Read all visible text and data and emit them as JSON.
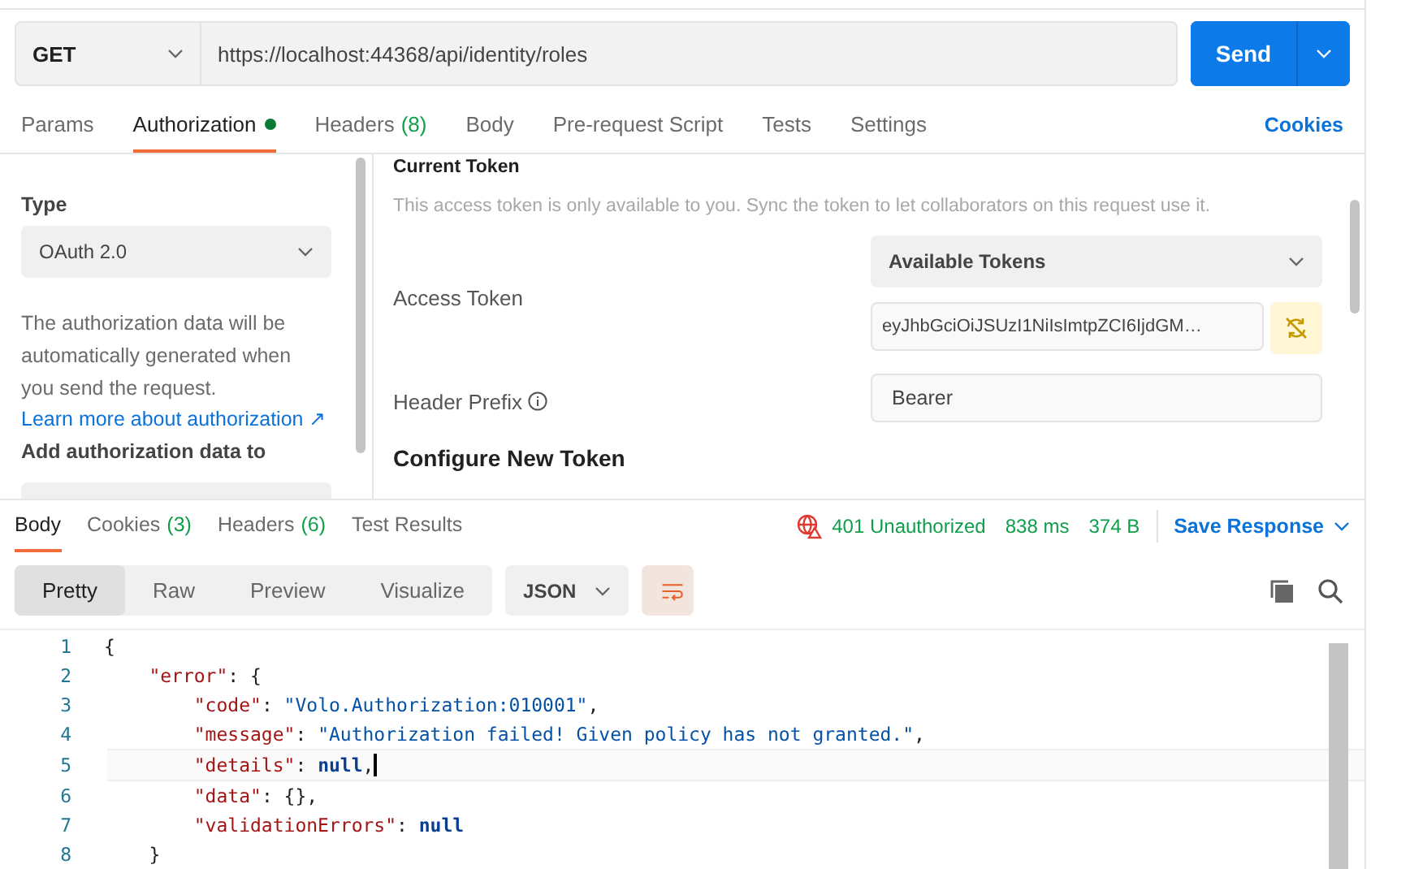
{
  "request": {
    "method": "GET",
    "url": "https://localhost:44368/api/identity/roles",
    "send_label": "Send"
  },
  "request_tabs": [
    {
      "label": "Params",
      "dot": false,
      "selected": false
    },
    {
      "label": "Authorization",
      "dot": true,
      "selected": true
    },
    {
      "label": "Headers",
      "count": "(8)",
      "dot": false,
      "selected": false
    },
    {
      "label": "Body",
      "dot": false,
      "selected": false
    },
    {
      "label": "Pre-request Script",
      "dot": false,
      "selected": false
    },
    {
      "label": "Tests",
      "dot": false,
      "selected": false
    },
    {
      "label": "Settings",
      "dot": false,
      "selected": false
    }
  ],
  "cookies_link": "Cookies",
  "auth_sidebar": {
    "type_label": "Type",
    "type_value": "OAuth 2.0",
    "description": "The authorization data will be automatically generated when you send the request.",
    "learn_link": "Learn more about authorization ↗",
    "add_label": "Add authorization data to"
  },
  "current_token": {
    "title": "Current Token",
    "note": "This access token is only available to you. Sync the token to let collaborators on this request use it.",
    "access_label": "Access Token",
    "tokens_dropdown": "Available Tokens",
    "token_value": "eyJhbGciOiJSUzI1NiIsImtpZCI6IjdGM…",
    "prefix_label": "Header Prefix",
    "prefix_value": "Bearer",
    "configure_title": "Configure New Token"
  },
  "response_tabs": [
    {
      "label": "Body",
      "selected": true
    },
    {
      "label": "Cookies",
      "count": "(3)",
      "selected": false
    },
    {
      "label": "Headers",
      "count": "(6)",
      "selected": false
    },
    {
      "label": "Test Results",
      "selected": false
    }
  ],
  "response_status": {
    "status": "401 Unauthorized",
    "time": "838 ms",
    "size": "374 B",
    "save": "Save Response"
  },
  "view_modes": [
    {
      "label": "Pretty",
      "selected": true
    },
    {
      "label": "Raw",
      "selected": false
    },
    {
      "label": "Preview",
      "selected": false
    },
    {
      "label": "Visualize",
      "selected": false
    }
  ],
  "format": "JSON",
  "wrap_on": true,
  "code_lines": [
    {
      "number": "1",
      "current": false,
      "tokens": [
        {
          "kind": "punct",
          "text": "{"
        }
      ]
    },
    {
      "number": "2",
      "current": false,
      "tokens": [
        {
          "kind": "key",
          "text": "    \"error\""
        },
        {
          "kind": "punct",
          "text": ": {"
        }
      ]
    },
    {
      "number": "3",
      "current": false,
      "tokens": [
        {
          "kind": "key",
          "text": "        \"code\""
        },
        {
          "kind": "punct",
          "text": ": "
        },
        {
          "kind": "string",
          "text": "\"Volo.Authorization:010001\""
        },
        {
          "kind": "punct",
          "text": ","
        }
      ]
    },
    {
      "number": "4",
      "current": false,
      "tokens": [
        {
          "kind": "key",
          "text": "        \"message\""
        },
        {
          "kind": "punct",
          "text": ": "
        },
        {
          "kind": "string",
          "text": "\"Authorization failed! Given policy has not granted.\""
        },
        {
          "kind": "punct",
          "text": ","
        }
      ]
    },
    {
      "number": "5",
      "current": true,
      "tokens": [
        {
          "kind": "key",
          "text": "        \"details\""
        },
        {
          "kind": "punct",
          "text": ": "
        },
        {
          "kind": "null",
          "text": "null"
        },
        {
          "kind": "punct",
          "text": ","
        }
      ]
    },
    {
      "number": "6",
      "current": false,
      "tokens": [
        {
          "kind": "key",
          "text": "        \"data\""
        },
        {
          "kind": "punct",
          "text": ": {},"
        }
      ]
    },
    {
      "number": "7",
      "current": false,
      "tokens": [
        {
          "kind": "key",
          "text": "        \"validationErrors\""
        },
        {
          "kind": "punct",
          "text": ": "
        },
        {
          "kind": "null",
          "text": "null"
        }
      ]
    },
    {
      "number": "8",
      "current": false,
      "tokens": [
        {
          "kind": "punct",
          "text": "    }"
        }
      ]
    }
  ]
}
